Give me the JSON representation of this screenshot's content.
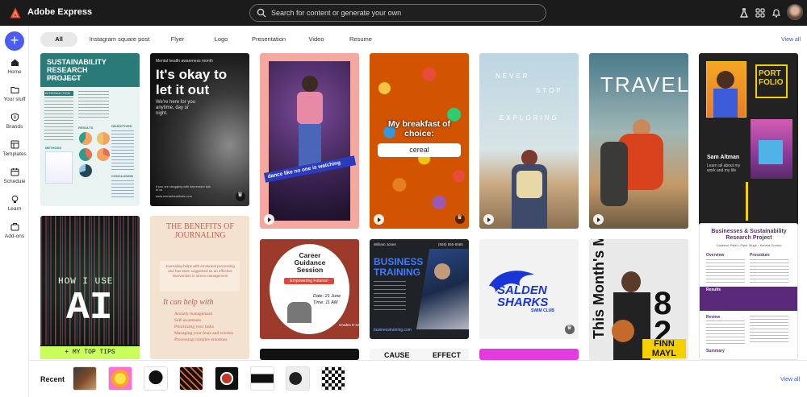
{
  "app": {
    "title": "Adobe Express",
    "search_placeholder": "Search for content or generate your own"
  },
  "toolbar_icons": [
    "flask-icon",
    "apps-grid-icon",
    "bell-icon"
  ],
  "rail": {
    "create_label": "+",
    "items": [
      {
        "label": "Home",
        "icon": "home-icon"
      },
      {
        "label": "Your stuff",
        "icon": "folder-icon"
      },
      {
        "label": "Brands",
        "icon": "brand-icon"
      },
      {
        "label": "Templates",
        "icon": "templates-icon"
      },
      {
        "label": "Schedule",
        "icon": "calendar-icon"
      },
      {
        "label": "Learn",
        "icon": "lightbulb-icon"
      },
      {
        "label": "Add-ons",
        "icon": "addons-icon"
      }
    ]
  },
  "tabs": [
    "All",
    "Instagram square post",
    "Flyer",
    "Logo",
    "Presentation",
    "Video",
    "Resume"
  ],
  "view_all": "View all",
  "templates": {
    "sustainability": {
      "title": "SUSTAINABILITY RESEARCH PROJECT",
      "sub": "Sponsor Schoolsustain",
      "sections": [
        "INTRODUCTION",
        "METHODS",
        "OBJECTIVES",
        "RESULTS",
        "CONCLUSION"
      ]
    },
    "okay": {
      "kicker": "Mental health awareness month",
      "title": "It's okay to let it out",
      "body": "We're here for you anytime, day or night.",
      "footer": "If you are struggling with depression talk to us",
      "url": "www.mentalhealthsite.com"
    },
    "dance": {
      "caption": "dance like no one is watching"
    },
    "breakfast": {
      "title": "My breakfast of choice:",
      "answer": "cereal"
    },
    "explore": {
      "words": [
        "NEVER",
        "STOP",
        "EXPLORING"
      ]
    },
    "travel": {
      "title": "TRAVEL"
    },
    "portfolio": {
      "title": "PORT FOLIO",
      "name": "Sam Altman",
      "blurb": "Learn all about my work and my life"
    },
    "ai": {
      "line1": "HOW I USE",
      "line2": "AI",
      "footer": "+ MY TOP TIPS"
    },
    "journaling": {
      "title": "THE BENEFITS OF JOURNALING",
      "intro": "Journaling helps with emotional processing and has been suggested as an effective intervention in stress management",
      "subtitle": "It can help with",
      "points": [
        "Anxiety management",
        "Self-awareness",
        "Prioritizing your tasks",
        "Managing your fears and worries",
        "Processing complex emotions"
      ]
    },
    "career": {
      "title": "Career Guidance Session",
      "tag": "Empowering Futures!",
      "date": "Date: 21 June",
      "time": "Time: 11 AM",
      "grade": "Grades 9-12"
    },
    "business": {
      "name": "William Jones",
      "phone": "(555) 555-5555",
      "title": "BUSINESS TRAINING",
      "url": "businesstraining.com"
    },
    "sharks": {
      "name": "SALDEN SHARKS",
      "sub": "SWIM CLUB"
    },
    "mvp": {
      "line": "This Month's MVP",
      "number": "82",
      "name": "FINN MAYL"
    },
    "report": {
      "title": "Businesses & Sustainability Research Project",
      "authors": "Cadence Patel • Piper Singh • Kahina Gordon",
      "cols": [
        "Overview",
        "Procedure",
        "Results",
        "Review",
        "Summary"
      ]
    },
    "row3": [
      "CAUSE",
      "EFFECT"
    ]
  },
  "recent": {
    "label": "Recent",
    "view_all": "View all",
    "count": 8
  }
}
